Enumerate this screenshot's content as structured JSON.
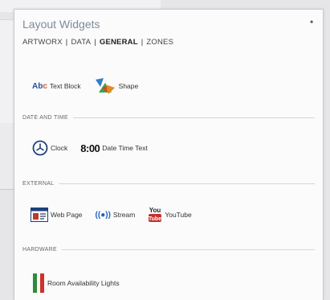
{
  "panel": {
    "title": "Layout Widgets",
    "pin_icon": "pin-icon",
    "close_glyph": "•"
  },
  "tabs": [
    {
      "label": "ARTWORX",
      "active": false
    },
    {
      "label": "DATA",
      "active": false
    },
    {
      "label": "GENERAL",
      "active": true
    },
    {
      "label": "ZONES",
      "active": false
    }
  ],
  "tab_separator": "|",
  "general_items": [
    {
      "label": "Text Block",
      "icon": "text-block-icon",
      "icon_text": "Abc"
    },
    {
      "label": "Shape",
      "icon": "shape-icon"
    }
  ],
  "sections": {
    "date_time": {
      "header": "DATE AND TIME",
      "items": [
        {
          "label": "Clock",
          "icon": "clock-icon"
        },
        {
          "label": "Date Time Text",
          "icon": "date-time-text-icon",
          "icon_text": "8:00"
        }
      ]
    },
    "external": {
      "header": "EXTERNAL",
      "items": [
        {
          "label": "Web Page",
          "icon": "web-page-icon"
        },
        {
          "label": "Stream",
          "icon": "stream-icon",
          "icon_text": "((●))"
        },
        {
          "label": "YouTube",
          "icon": "youtube-icon",
          "icon_text": "You Tube"
        }
      ]
    },
    "hardware": {
      "header": "HARDWARE",
      "items": [
        {
          "label": "Room Availability Lights",
          "icon": "room-lights-icon"
        }
      ]
    }
  },
  "colors": {
    "title": "#7e8b99",
    "accent_blue": "#2a4e9a",
    "youtube_red": "#c4302b",
    "light_green": "#2e8b3a",
    "light_red": "#d0322a"
  }
}
